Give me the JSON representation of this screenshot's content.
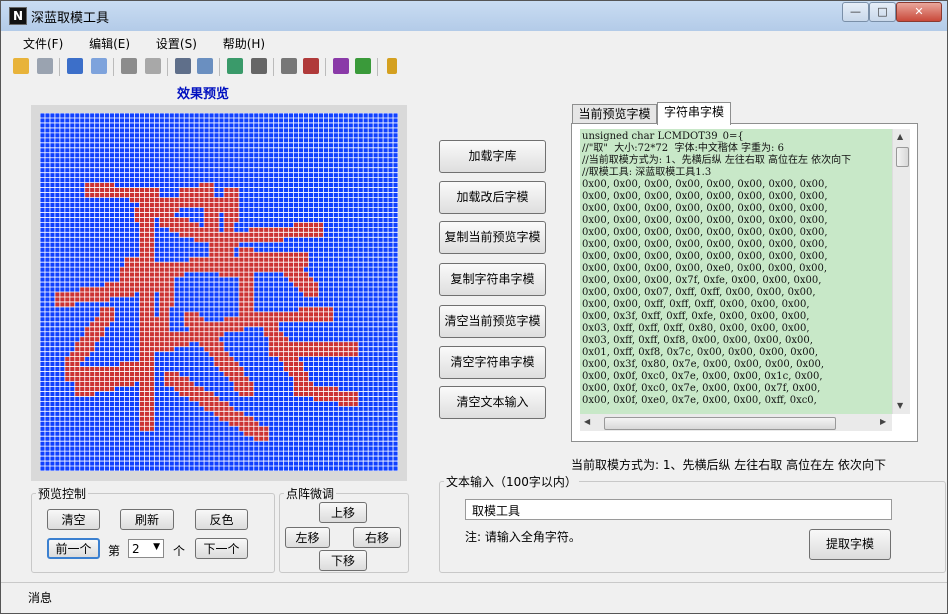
{
  "app": {
    "title": "深蓝取模工具",
    "icon_letter": "N"
  },
  "window_controls": {
    "minimize": "—",
    "maximize": "□",
    "close": "✕"
  },
  "menu": [
    "文件(F)",
    "编辑(E)",
    "设置(S)",
    "帮助(H)"
  ],
  "toolbar_icons": [
    "open-folder-icon",
    "clear-icon",
    "save-icon",
    "save-as-icon",
    "save2-icon",
    "save-all-icon",
    "print-icon",
    "export-icon",
    "import-icon",
    "tools-icon",
    "settings-icon",
    "cut-icon",
    "book-icon",
    "library-icon",
    "lock-icon"
  ],
  "preview": {
    "title": "效果预览",
    "pixel_color": "#cc3333",
    "bg_color": "#1040ff",
    "grid_color": "#ffffff"
  },
  "preview_control": {
    "legend": "预览控制",
    "clear": "清空",
    "refresh": "刷新",
    "invert": "反色",
    "prev": "前一个",
    "page_label": "第",
    "page_value": "2",
    "page_unit": "个",
    "next": "下一个"
  },
  "dot_adjust": {
    "legend": "点阵微调",
    "up": "上移",
    "left": "左移",
    "right": "右移",
    "down": "下移"
  },
  "actions": [
    "加载字库",
    "加载改后字模",
    "复制当前预览字模",
    "复制字符串字模",
    "清空当前预览字模",
    "清空字符串字模",
    "清空文本输入"
  ],
  "tabs": [
    {
      "label": "当前预览字模",
      "active": false
    },
    {
      "label": "字符串字模",
      "active": true
    }
  ],
  "code_lines": [
    "unsigned char LCMDOT39_0={",
    "//\"取\"  大小:72*72  字体:中文楷体 字重为: 6",
    "//当前取模方式为: 1、先横后纵 左往右取 高位在左 依次向下",
    "//取模工具: 深蓝取模工具1.3",
    "0x00, 0x00, 0x00, 0x00, 0x00, 0x00, 0x00, 0x00,",
    "0x00, 0x00, 0x00, 0x00, 0x00, 0x00, 0x00, 0x00,",
    "0x00, 0x00, 0x00, 0x00, 0x00, 0x00, 0x00, 0x00,",
    "0x00, 0x00, 0x00, 0x00, 0x00, 0x00, 0x00, 0x00,",
    "0x00, 0x00, 0x00, 0x00, 0x00, 0x00, 0x00, 0x00,",
    "0x00, 0x00, 0x00, 0x00, 0x00, 0x00, 0x00, 0x00,",
    "0x00, 0x00, 0x00, 0x00, 0x00, 0x00, 0x00, 0x00,",
    "0x00, 0x00, 0x00, 0x00, 0xe0, 0x00, 0x00, 0x00,",
    "0x00, 0x00, 0x00, 0x7f, 0xfe, 0x00, 0x00, 0x00,",
    "0x00, 0x00, 0x07, 0xff, 0xff, 0x00, 0x00, 0x00,",
    "0x00, 0x00, 0xff, 0xff, 0xff, 0x00, 0x00, 0x00,",
    "0x00, 0x3f, 0xff, 0xff, 0xfe, 0x00, 0x00, 0x00,",
    "0x03, 0xff, 0xff, 0xff, 0x80, 0x00, 0x00, 0x00,",
    "0x03, 0xff, 0xff, 0xf8, 0x00, 0x00, 0x00, 0x00,",
    "0x01, 0xff, 0xf8, 0x7c, 0x00, 0x00, 0x00, 0x00,",
    "0x00, 0x3f, 0x80, 0x7e, 0x00, 0x00, 0x00, 0x00,",
    "0x00, 0x0f, 0xc0, 0x7e, 0x00, 0x00, 0x1c, 0x00,",
    "0x00, 0x0f, 0xc0, 0x7e, 0x00, 0x00, 0x7f, 0x00,",
    "0x00, 0x0f, 0xe0, 0x7e, 0x00, 0x00, 0xff, 0xc0,"
  ],
  "mode_text": "当前取模方式为: 1、先横后纵 左往右取 高位在左 依次向下",
  "text_input": {
    "legend": "文本输入（100字以内）",
    "value": "取模工具",
    "note": "注: 请输入全角字符。",
    "button": "提取字模"
  },
  "status": "消息"
}
